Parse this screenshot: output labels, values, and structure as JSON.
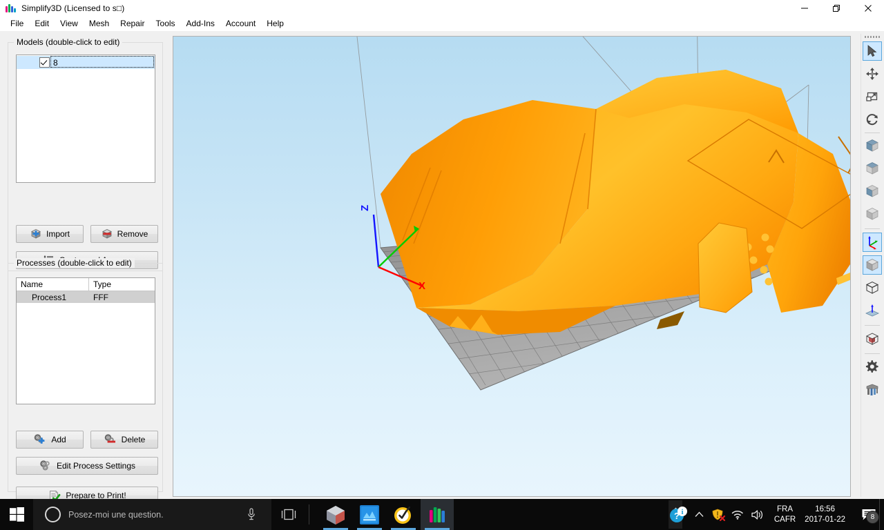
{
  "window": {
    "title": "Simplify3D (Licensed to s□)",
    "app_icon": "simplify3d-logo-icon",
    "controls": [
      {
        "name": "minimize-button",
        "icon": "minimize-icon",
        "label": "—"
      },
      {
        "name": "maximize-button",
        "icon": "restore-icon",
        "label": "❐"
      },
      {
        "name": "close-button",
        "icon": "close-icon",
        "label": "✕"
      }
    ]
  },
  "menubar": {
    "items": [
      {
        "label": "File"
      },
      {
        "label": "Edit"
      },
      {
        "label": "View"
      },
      {
        "label": "Mesh"
      },
      {
        "label": "Repair"
      },
      {
        "label": "Tools"
      },
      {
        "label": "Add-Ins"
      },
      {
        "label": "Account"
      },
      {
        "label": "Help"
      }
    ]
  },
  "models_panel": {
    "title": "Models (double-click to edit)",
    "items": [
      {
        "label": "8",
        "checked": true,
        "selected": true
      }
    ],
    "buttons": [
      {
        "name": "import-button",
        "label": "Import",
        "icon": "cube-plus-icon"
      },
      {
        "name": "remove-button",
        "label": "Remove",
        "icon": "cube-minus-icon"
      },
      {
        "name": "center-and-arrange-button",
        "label": "Center and Arrange",
        "icon": "arrange-icon"
      }
    ]
  },
  "processes_panel": {
    "title": "Processes (double-click to edit)",
    "columns": [
      "Name",
      "Type"
    ],
    "rows": [
      {
        "name": "Process1",
        "type": "FFF",
        "selected": true
      }
    ],
    "buttons": [
      {
        "name": "add-process-button",
        "label": "Add",
        "icon": "gears-plus-icon"
      },
      {
        "name": "delete-process-button",
        "label": "Delete",
        "icon": "gears-minus-icon"
      },
      {
        "name": "edit-process-settings-button",
        "label": "Edit Process Settings",
        "icon": "gears-icon"
      },
      {
        "name": "prepare-to-print-button",
        "label": "Prepare to Print!",
        "icon": "document-check-icon"
      }
    ]
  },
  "viewport": {
    "background_top_color": "#b6dcf2",
    "background_bottom_color": "#e8f5fd",
    "buildplate_color": "#9a9a9a",
    "model_color": "#FFA000",
    "model_highlight_color": "#FFC028",
    "axes": [
      {
        "name": "z-axis",
        "label": "Z",
        "color": "#1414ff"
      },
      {
        "name": "y-axis",
        "label": "",
        "color": "#00cc00"
      },
      {
        "name": "x-axis",
        "label": "X",
        "color": "#ff0000"
      }
    ]
  },
  "right_toolbar": {
    "tools": [
      {
        "name": "select-tool",
        "icon": "cursor-arrow-icon",
        "selected": true
      },
      {
        "name": "move-tool",
        "icon": "move-arrows-icon",
        "selected": false
      },
      {
        "name": "scale-tool",
        "icon": "scale-icon",
        "selected": false
      },
      {
        "name": "rotate-tool",
        "icon": "rotate-icon",
        "selected": false
      },
      {
        "name": "view-front-tool",
        "icon": "cube-front-icon",
        "selected": false
      },
      {
        "name": "view-top-tool",
        "icon": "cube-top-icon",
        "selected": false
      },
      {
        "name": "view-side-tool",
        "icon": "cube-side-icon",
        "selected": false
      },
      {
        "name": "view-iso-tool",
        "icon": "cube-iso-icon",
        "selected": false
      },
      {
        "name": "show-axes-tool",
        "icon": "axes-icon",
        "selected": true
      },
      {
        "name": "solid-view-tool",
        "icon": "solid-cube-icon",
        "selected": true
      },
      {
        "name": "wireframe-view-tool",
        "icon": "wireframe-cube-icon",
        "selected": false
      },
      {
        "name": "normals-view-tool",
        "icon": "normal-arrow-icon",
        "selected": false
      },
      {
        "name": "cross-section-tool",
        "icon": "cross-section-cube-icon",
        "selected": false
      },
      {
        "name": "settings-tool",
        "icon": "gear-icon",
        "selected": false
      },
      {
        "name": "extruders-tool",
        "icon": "extruders-icon",
        "selected": false
      }
    ]
  },
  "taskbar": {
    "start_button": {
      "name": "start-button",
      "icon": "windows-logo-icon"
    },
    "search": {
      "name": "cortana-search",
      "placeholder": "Posez-moi une question.",
      "circle_icon": "cortana-circle-icon",
      "mic_icon": "microphone-icon"
    },
    "task_view": {
      "name": "task-view-button",
      "icon": "task-view-icon"
    },
    "apps": [
      {
        "name": "taskbar-app-3dbuilder",
        "icon": "polyhedron-icon",
        "active": false
      },
      {
        "name": "taskbar-app-blue",
        "icon": "blue-app-icon",
        "active": false
      },
      {
        "name": "taskbar-app-antivirus",
        "icon": "yellow-check-icon",
        "active": false
      },
      {
        "name": "taskbar-app-simplify3d",
        "icon": "simplify3d-logo-icon",
        "active": true
      }
    ],
    "scroller": {
      "name": "taskbar-scroller",
      "up_icon": "chevron-up-icon",
      "down_icon": "chevron-down-icon"
    },
    "tray": {
      "icons": [
        {
          "name": "tray-info-icon",
          "icon": "info-bubble-icon"
        },
        {
          "name": "tray-show-hidden-icon",
          "icon": "chevron-up-icon"
        },
        {
          "name": "tray-security-icon",
          "icon": "shield-alert-icon"
        },
        {
          "name": "tray-network-icon",
          "icon": "wifi-icon"
        },
        {
          "name": "tray-volume-icon",
          "icon": "speaker-icon"
        }
      ],
      "language": {
        "line1": "FRA",
        "line2": "CAFR"
      },
      "clock": {
        "time": "16:56",
        "date": "2017-01-22"
      },
      "notifications": {
        "name": "action-center-button",
        "icon": "speech-bubble-icon",
        "badge": "8"
      }
    }
  }
}
